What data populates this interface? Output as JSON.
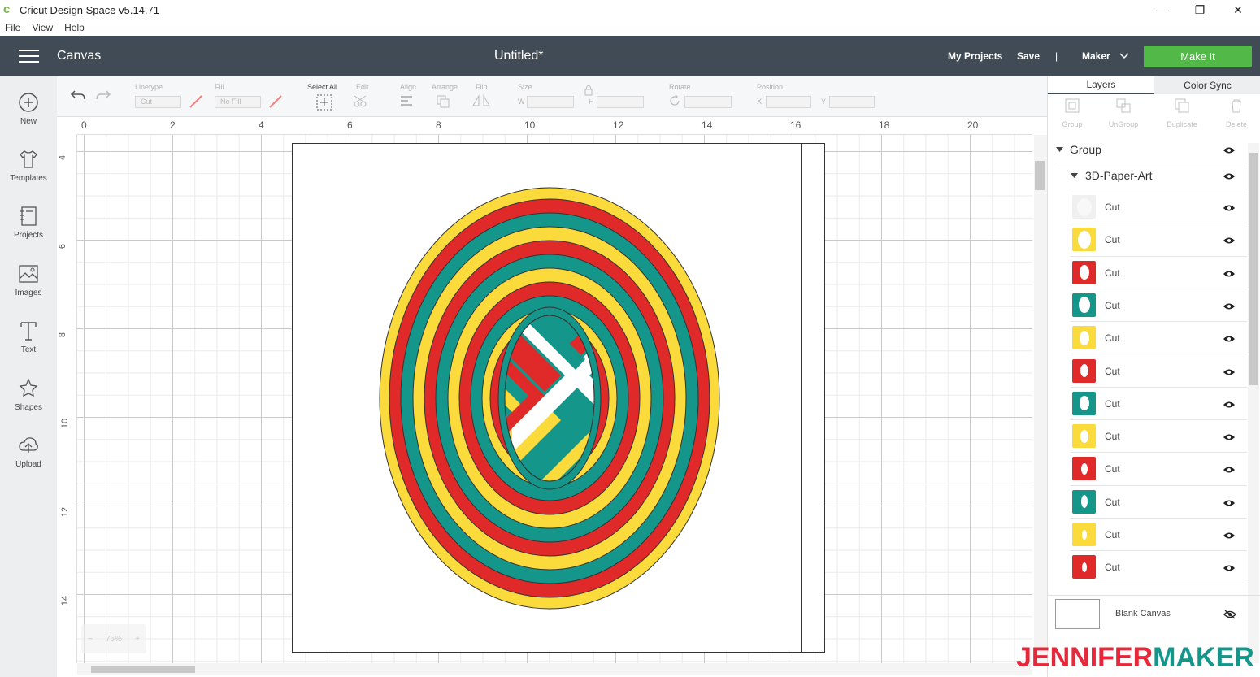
{
  "app": {
    "title": "Cricut Design Space  v5.14.71",
    "logo_glyph": "c"
  },
  "window_controls": {
    "minimize": "—",
    "restore": "❐",
    "close": "✕"
  },
  "menu": [
    "File",
    "View",
    "Help"
  ],
  "header": {
    "section": "Canvas",
    "document": "Untitled*",
    "my_projects": "My Projects",
    "save": "Save",
    "separator": "|",
    "machine": "Maker",
    "make_it": "Make It"
  },
  "sidebar": [
    {
      "label": "New",
      "icon": "plus-circle-icon"
    },
    {
      "label": "Templates",
      "icon": "tshirt-icon"
    },
    {
      "label": "Projects",
      "icon": "notebook-icon"
    },
    {
      "label": "Images",
      "icon": "image-icon"
    },
    {
      "label": "Text",
      "icon": "text-t-icon"
    },
    {
      "label": "Shapes",
      "icon": "shapes-icon"
    },
    {
      "label": "Upload",
      "icon": "cloud-upload-icon"
    }
  ],
  "toolbar": {
    "linetype_label": "Linetype",
    "linetype_value": "Cut",
    "fill_label": "Fill",
    "fill_value": "No Fill",
    "select_all": "Select All",
    "edit": "Edit",
    "align": "Align",
    "arrange": "Arrange",
    "flip": "Flip",
    "size": "Size",
    "w": "W",
    "h": "H",
    "rotate": "Rotate",
    "position": "Position",
    "x": "X",
    "y": "Y"
  },
  "ruler": {
    "top": [
      "0",
      "2",
      "4",
      "6",
      "8",
      "10",
      "12",
      "14",
      "16",
      "18",
      "20"
    ],
    "left": [
      "4",
      "6",
      "8",
      "10",
      "12",
      "14"
    ]
  },
  "zoom": {
    "minus": "−",
    "value": "75%",
    "plus": "+"
  },
  "panel": {
    "tabs": [
      "Layers",
      "Color Sync"
    ],
    "tools": [
      "Group",
      "UnGroup",
      "Duplicate",
      "Delete"
    ],
    "group": "Group",
    "subgroup": "3D-Paper-Art",
    "layers": [
      {
        "label": "Cut",
        "color": "#f0f0f0"
      },
      {
        "label": "Cut",
        "color": "#fbdb3c"
      },
      {
        "label": "Cut",
        "color": "#e02a2a"
      },
      {
        "label": "Cut",
        "color": "#14968a"
      },
      {
        "label": "Cut",
        "color": "#fbdb3c"
      },
      {
        "label": "Cut",
        "color": "#e02a2a"
      },
      {
        "label": "Cut",
        "color": "#14968a"
      },
      {
        "label": "Cut",
        "color": "#fbdb3c"
      },
      {
        "label": "Cut",
        "color": "#e02a2a"
      },
      {
        "label": "Cut",
        "color": "#14968a"
      },
      {
        "label": "Cut",
        "color": "#fbdb3c"
      },
      {
        "label": "Cut",
        "color": "#e02a2a"
      }
    ],
    "blank_canvas": "Blank Canvas"
  },
  "watermark": {
    "part1": "JENNIFER",
    "part2": "MAKER",
    "color1": "#e8283a",
    "color2": "#14968a"
  },
  "colors": {
    "header": "#414b55",
    "make_it": "#52b848",
    "yellow": "#fbdb3c",
    "red": "#e02a2a",
    "teal": "#14968a"
  }
}
